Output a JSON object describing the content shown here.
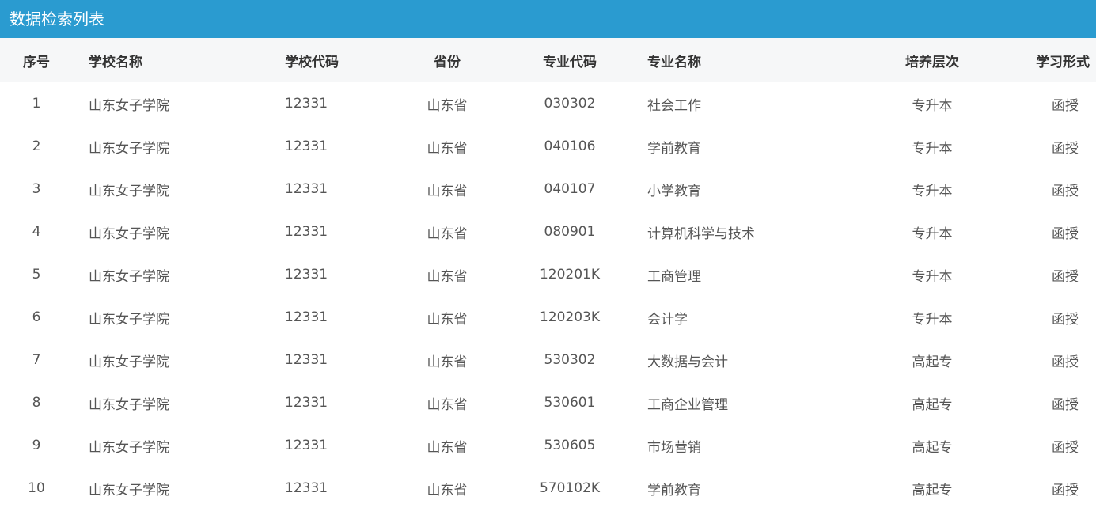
{
  "title": "数据检索列表",
  "columns": {
    "index": "序号",
    "school_name": "学校名称",
    "school_code": "学校代码",
    "province": "省份",
    "major_code": "专业代码",
    "major_name": "专业名称",
    "level": "培养层次",
    "study_mode": "学习形式"
  },
  "rows": [
    {
      "index": "1",
      "school_name": "山东女子学院",
      "school_code": "12331",
      "province": "山东省",
      "major_code": "030302",
      "major_name": "社会工作",
      "level": "专升本",
      "study_mode": "函授"
    },
    {
      "index": "2",
      "school_name": "山东女子学院",
      "school_code": "12331",
      "province": "山东省",
      "major_code": "040106",
      "major_name": "学前教育",
      "level": "专升本",
      "study_mode": "函授"
    },
    {
      "index": "3",
      "school_name": "山东女子学院",
      "school_code": "12331",
      "province": "山东省",
      "major_code": "040107",
      "major_name": "小学教育",
      "level": "专升本",
      "study_mode": "函授"
    },
    {
      "index": "4",
      "school_name": "山东女子学院",
      "school_code": "12331",
      "province": "山东省",
      "major_code": "080901",
      "major_name": "计算机科学与技术",
      "level": "专升本",
      "study_mode": "函授"
    },
    {
      "index": "5",
      "school_name": "山东女子学院",
      "school_code": "12331",
      "province": "山东省",
      "major_code": "120201K",
      "major_name": "工商管理",
      "level": "专升本",
      "study_mode": "函授"
    },
    {
      "index": "6",
      "school_name": "山东女子学院",
      "school_code": "12331",
      "province": "山东省",
      "major_code": "120203K",
      "major_name": "会计学",
      "level": "专升本",
      "study_mode": "函授"
    },
    {
      "index": "7",
      "school_name": "山东女子学院",
      "school_code": "12331",
      "province": "山东省",
      "major_code": "530302",
      "major_name": "大数据与会计",
      "level": "高起专",
      "study_mode": "函授"
    },
    {
      "index": "8",
      "school_name": "山东女子学院",
      "school_code": "12331",
      "province": "山东省",
      "major_code": "530601",
      "major_name": "工商企业管理",
      "level": "高起专",
      "study_mode": "函授"
    },
    {
      "index": "9",
      "school_name": "山东女子学院",
      "school_code": "12331",
      "province": "山东省",
      "major_code": "530605",
      "major_name": "市场营销",
      "level": "高起专",
      "study_mode": "函授"
    },
    {
      "index": "10",
      "school_name": "山东女子学院",
      "school_code": "12331",
      "province": "山东省",
      "major_code": "570102K",
      "major_name": "学前教育",
      "level": "高起专",
      "study_mode": "函授"
    }
  ],
  "colors": {
    "title_bar": "#2a9bd0",
    "header_bg": "#f6f7f8",
    "text": "#555555"
  }
}
